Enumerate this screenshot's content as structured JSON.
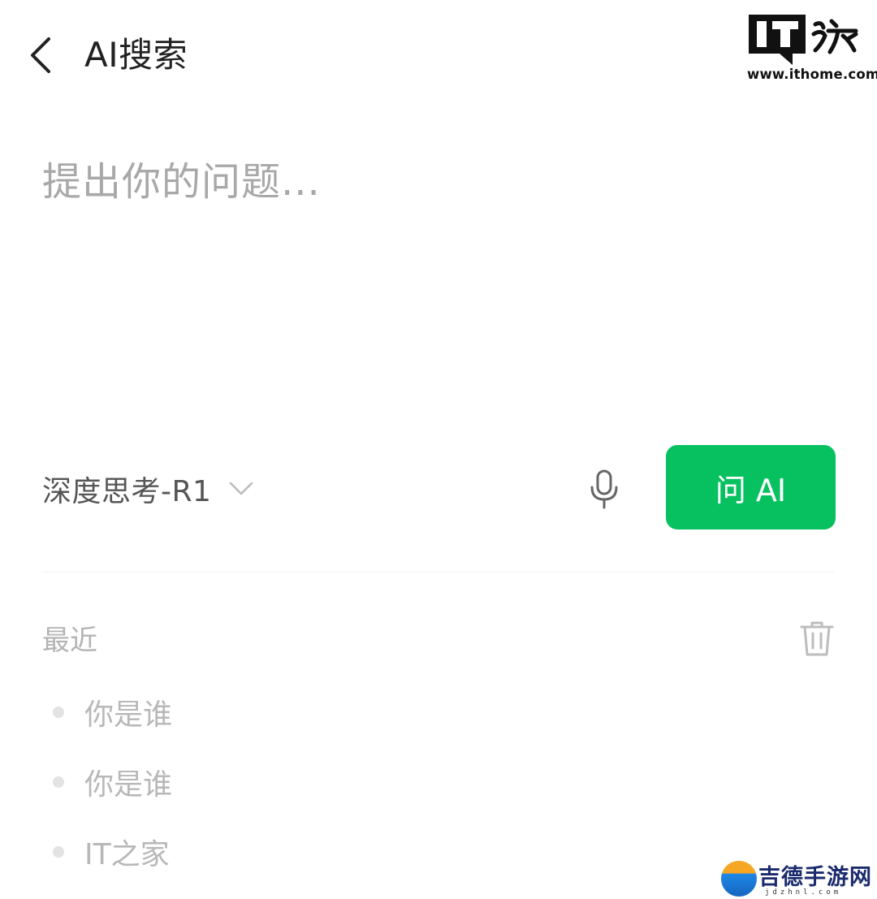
{
  "header": {
    "back_icon": "chevron-left-icon",
    "title": "AI搜索"
  },
  "watermark": {
    "logo_text": "IT",
    "logo_glyphs": "之家",
    "url": "www.ithome.com"
  },
  "search": {
    "placeholder": "提出你的问题...",
    "value": ""
  },
  "toolbar": {
    "model_label": "深度思考-R1",
    "model_dropdown_icon": "chevron-down-icon",
    "mic_icon": "microphone-icon",
    "ask_button_label": "问 AI",
    "accent_color": "#07c160"
  },
  "recent": {
    "heading": "最近",
    "clear_icon": "trash-icon",
    "items": [
      {
        "label": "你是谁"
      },
      {
        "label": "你是谁"
      },
      {
        "label": "IT之家"
      }
    ]
  },
  "corner_watermark": {
    "brand": "吉德手游网",
    "url": "jdzhnl.com"
  }
}
